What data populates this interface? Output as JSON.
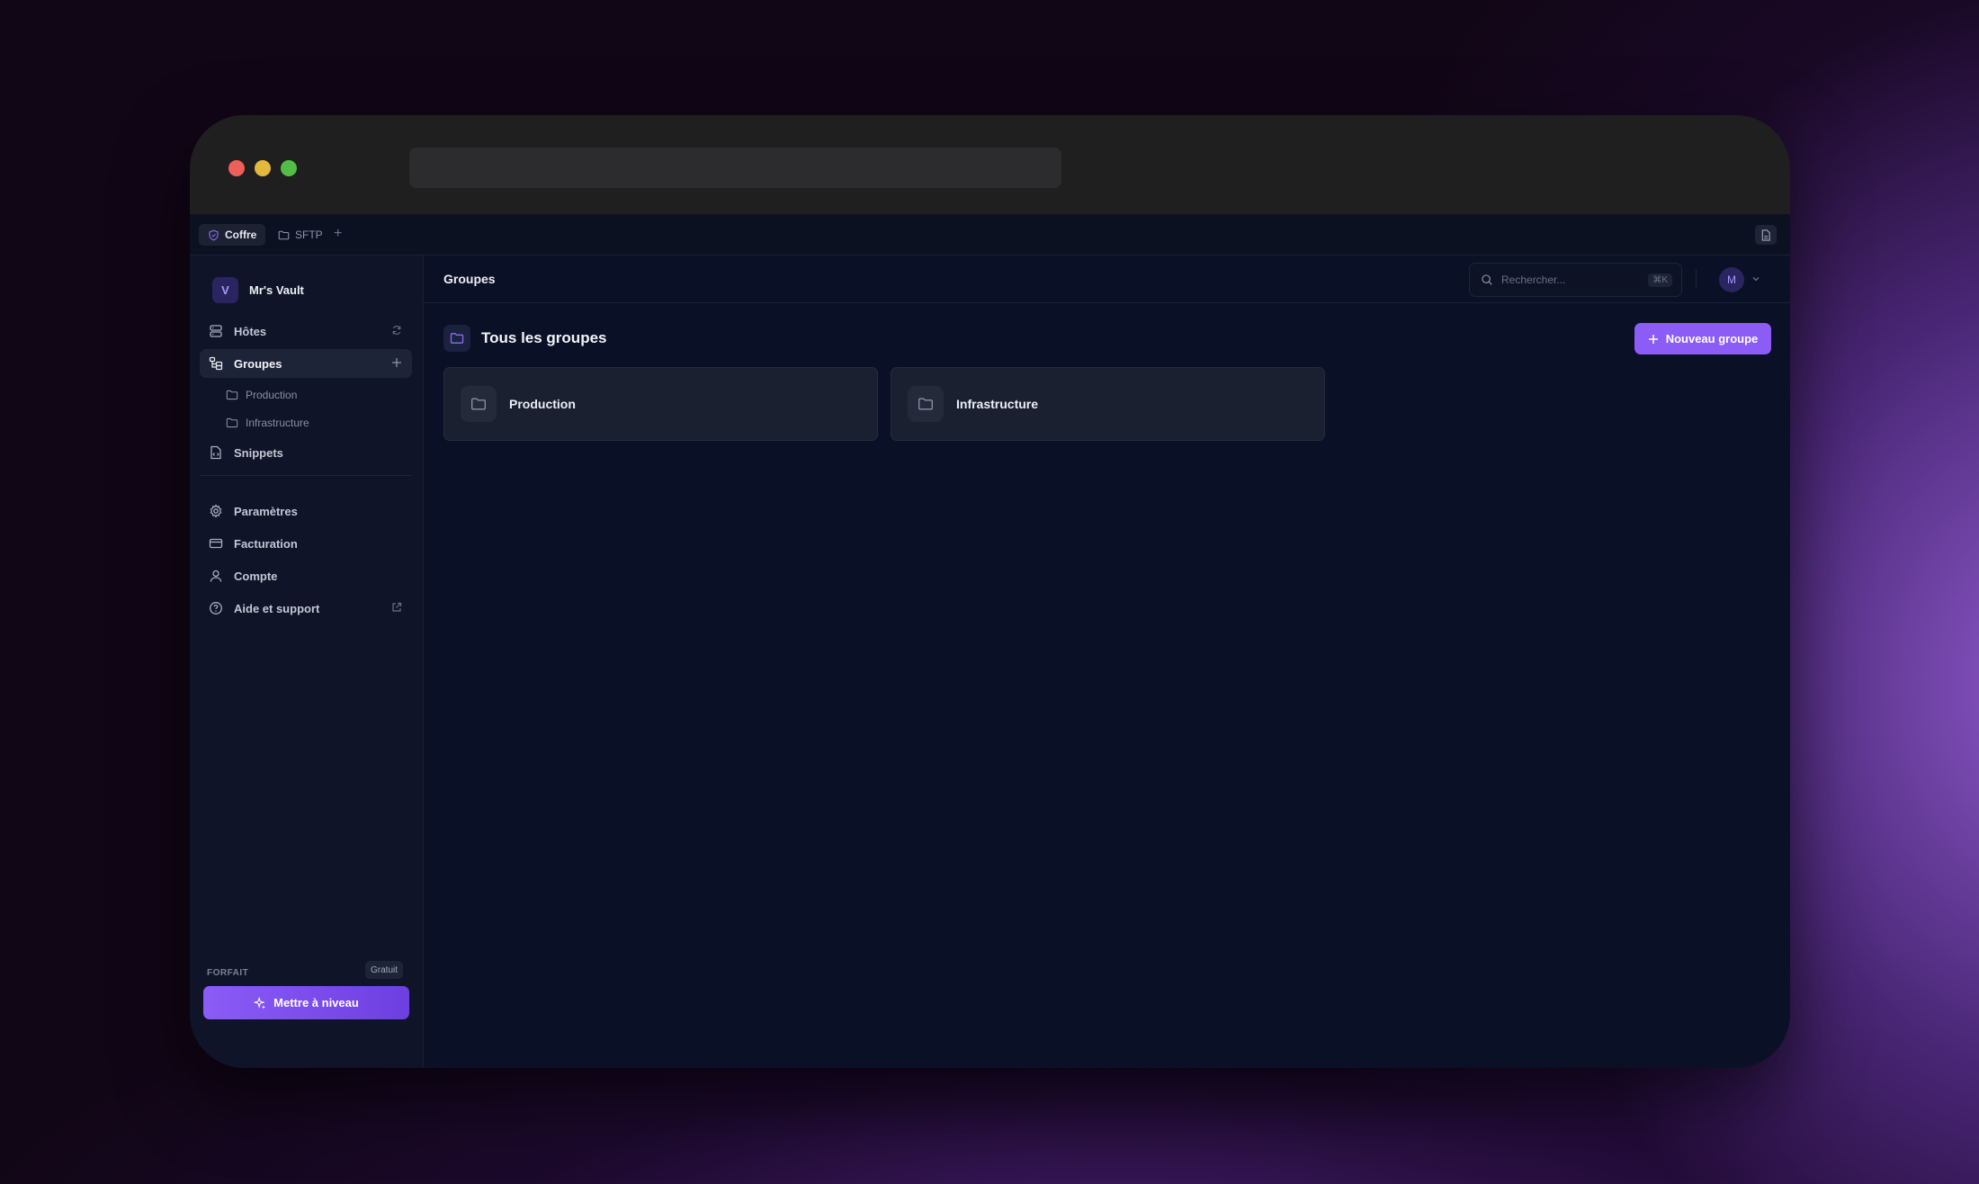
{
  "tabs": [
    {
      "label": "Coffre",
      "icon": "shield-icon",
      "active": true
    },
    {
      "label": "SFTP",
      "icon": "folder-icon",
      "active": false
    }
  ],
  "tab_add": "+",
  "sidebar": {
    "vault_initial": "V",
    "vault_name": "Mr's Vault",
    "items": [
      {
        "label": "Hôtes",
        "icon": "server-icon"
      },
      {
        "label": "Groupes",
        "icon": "groups-tree-icon"
      },
      {
        "label": "Snippets",
        "icon": "file-code-icon"
      },
      {
        "label": "Paramètres",
        "icon": "gear-icon"
      },
      {
        "label": "Facturation",
        "icon": "credit-card-icon"
      },
      {
        "label": "Compte",
        "icon": "user-icon"
      },
      {
        "label": "Aide et support",
        "icon": "help-circle-icon"
      }
    ],
    "subgroups": [
      "Production",
      "Infrastructure"
    ],
    "plan_label": "FORFAIT",
    "plan_value": "Gratuit",
    "upgrade_label": "Mettre à niveau"
  },
  "header": {
    "title": "Groupes",
    "search_placeholder": "Rechercher...",
    "search_shortcut": "⌘K",
    "user_initial": "M"
  },
  "main": {
    "section_title": "Tous les groupes",
    "new_group_label": "Nouveau groupe",
    "groups": [
      {
        "name": "Production"
      },
      {
        "name": "Infrastructure"
      }
    ]
  },
  "colors": {
    "accent": "#8b5cf6",
    "background": "#0a1026",
    "sidebar": "#0f1429",
    "card": "#1b2030"
  }
}
